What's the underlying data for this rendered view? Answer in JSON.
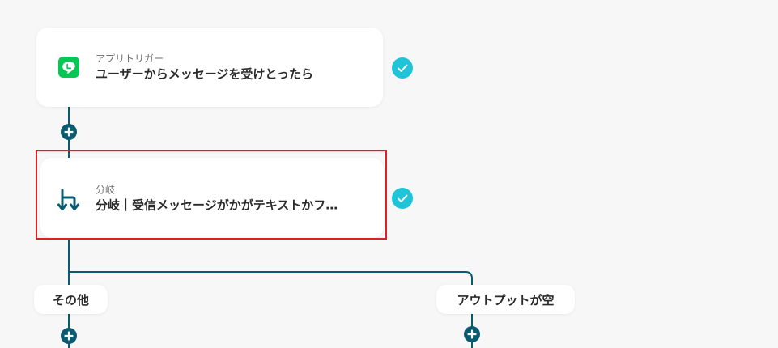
{
  "flow": {
    "trigger_step": {
      "subtitle": "アプリトリガー",
      "title": "ユーザーからメッセージを受けとったら",
      "icon": "line-app-icon",
      "status": "completed"
    },
    "branch_step": {
      "subtitle": "分岐",
      "title": "分岐｜受信メッセージがかがテキストかフ…",
      "icon": "branch-icon",
      "status": "completed"
    },
    "branches": [
      {
        "label": "その他"
      },
      {
        "label": "アウトプットが空"
      }
    ]
  },
  "colors": {
    "background": "#f7f7f7",
    "connector": "#0b5b70",
    "check_badge": "#20c4d8",
    "highlight": "#e02020",
    "line_brand": "#06c755"
  }
}
